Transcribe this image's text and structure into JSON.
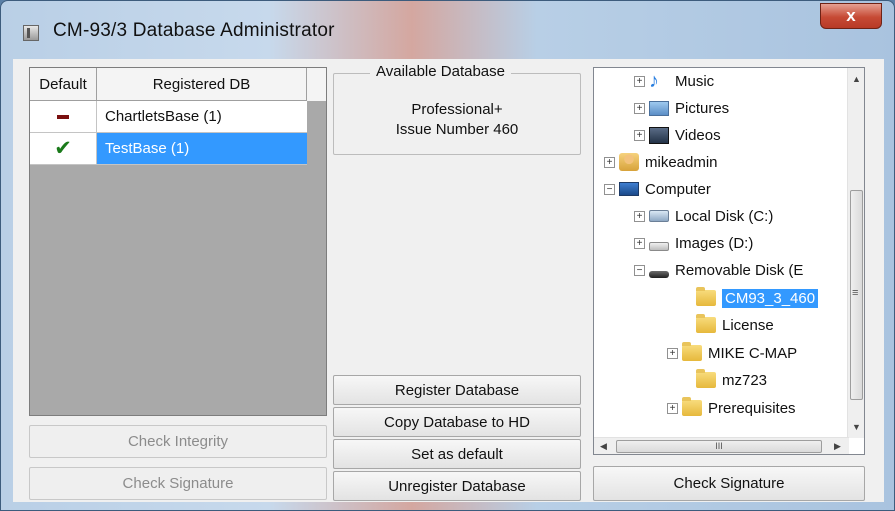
{
  "window": {
    "title": "CM-93/3 Database Administrator",
    "close_label": "x"
  },
  "registered_list": {
    "headers": {
      "default": "Default",
      "db": "Registered DB"
    },
    "rows": [
      {
        "default_icon": "dash-icon",
        "name": "ChartletsBase (1)",
        "selected": false
      },
      {
        "default_icon": "checkmark-icon",
        "name": "TestBase (1)",
        "selected": true
      }
    ]
  },
  "left_buttons": {
    "check_integrity": "Check Integrity",
    "check_signature": "Check Signature"
  },
  "available_database": {
    "title": "Available Database",
    "line1": "Professional+",
    "line2": "Issue Number 460"
  },
  "middle_buttons": {
    "register": "Register Database",
    "copy": "Copy Database to HD",
    "set_default": "Set as default",
    "unregister": "Unregister Database"
  },
  "tree": {
    "items": [
      {
        "label": "Music",
        "icon": "music-icon"
      },
      {
        "label": "Pictures",
        "icon": "pictures-icon"
      },
      {
        "label": "Videos",
        "icon": "videos-icon"
      },
      {
        "label": "mikeadmin",
        "icon": "user-folder-icon"
      },
      {
        "label": "Computer",
        "icon": "computer-icon"
      },
      {
        "label": "Local Disk (C:)",
        "icon": "local-disk-icon"
      },
      {
        "label": "Images (D:)",
        "icon": "drive-icon"
      },
      {
        "label": "Removable Disk (E",
        "icon": "removable-disk-icon"
      },
      {
        "label": "CM93_3_460",
        "icon": "folder-icon",
        "selected": true
      },
      {
        "label": "License",
        "icon": "folder-icon"
      },
      {
        "label": "MIKE C-MAP",
        "icon": "folder-icon"
      },
      {
        "label": "mz723",
        "icon": "folder-icon"
      },
      {
        "label": "Prerequisites",
        "icon": "folder-icon"
      }
    ],
    "hscroll_grip": "III"
  },
  "right_buttons": {
    "check_signature": "Check Signature"
  }
}
